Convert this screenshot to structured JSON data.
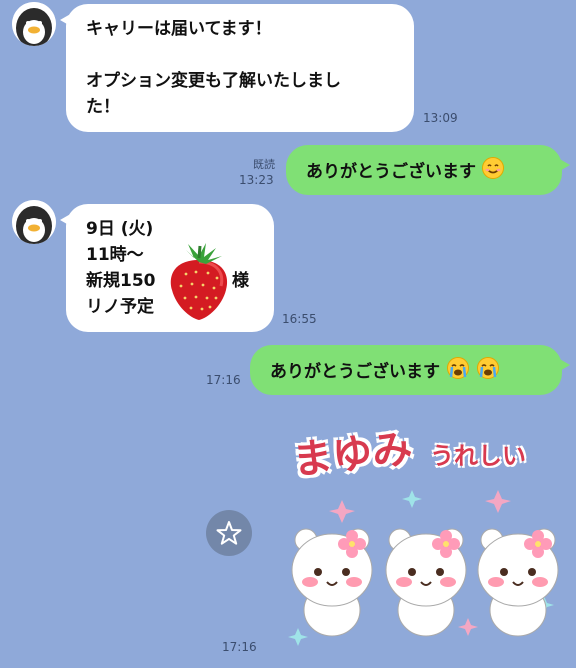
{
  "messages": [
    {
      "sender": "other",
      "lines": [
        "キャリーは届いてます！",
        "",
        "オプション変更も了解いたしまし",
        "た！"
      ],
      "time": "13:09",
      "avatar": "penguin-icon"
    },
    {
      "sender": "me",
      "text": "ありがとうございます",
      "emoji": "smiling-face-icon",
      "read": "既読",
      "time": "13:23"
    },
    {
      "sender": "other",
      "lines": [
        "9日 (火)",
        "11時〜",
        "新規150",
        "リノ予定"
      ],
      "trailing": "様",
      "emoji": "strawberry-icon",
      "time": "16:55",
      "avatar": "penguin-icon"
    },
    {
      "sender": "me",
      "text": "ありがとうございます",
      "emoji": "crying-face-icon",
      "time": "17:16"
    },
    {
      "sender": "me",
      "type": "sticker",
      "sticker_text_big": "まゆみ",
      "sticker_text_small": "うれしい",
      "time": "17:16"
    }
  ],
  "colors": {
    "background": "#8fa9d9",
    "my_bubble": "#80e075",
    "other_bubble": "#ffffff"
  }
}
